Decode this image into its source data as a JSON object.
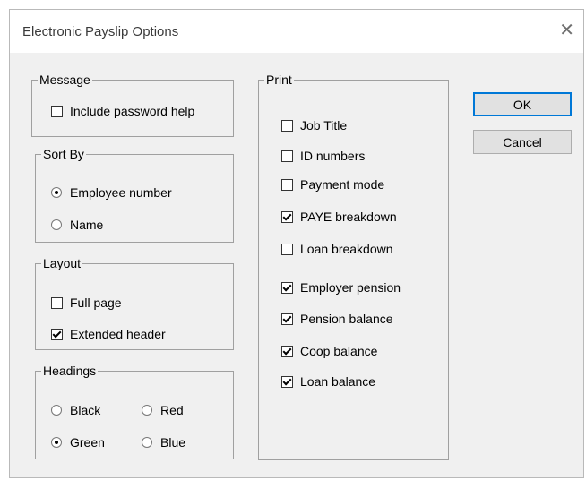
{
  "window": {
    "title": "Electronic Payslip Options",
    "close_glyph": "✕"
  },
  "message": {
    "legend": "Message",
    "include_password_help": {
      "label": "Include password help",
      "checked": false
    }
  },
  "sort_by": {
    "legend": "Sort By",
    "options": [
      {
        "label": "Employee number",
        "selected": true
      },
      {
        "label": "Name",
        "selected": false
      }
    ]
  },
  "layout": {
    "legend": "Layout",
    "options": [
      {
        "label": "Full page",
        "checked": false
      },
      {
        "label": "Extended header",
        "checked": true
      }
    ]
  },
  "headings": {
    "legend": "Headings",
    "options": [
      {
        "label": "Black",
        "selected": false
      },
      {
        "label": "Red",
        "selected": false
      },
      {
        "label": "Green",
        "selected": true
      },
      {
        "label": "Blue",
        "selected": false
      }
    ]
  },
  "print": {
    "legend": "Print",
    "items": [
      {
        "label": "Job Title",
        "checked": false
      },
      {
        "label": "ID numbers",
        "checked": false
      },
      {
        "label": "Payment mode",
        "checked": false
      },
      {
        "label": "PAYE breakdown",
        "checked": true
      },
      {
        "label": "Loan breakdown",
        "checked": false
      },
      {
        "label": "Employer pension",
        "checked": true
      },
      {
        "label": "Pension balance",
        "checked": true
      },
      {
        "label": "Coop balance",
        "checked": true
      },
      {
        "label": "Loan balance",
        "checked": true
      }
    ]
  },
  "buttons": {
    "ok": "OK",
    "cancel": "Cancel"
  }
}
